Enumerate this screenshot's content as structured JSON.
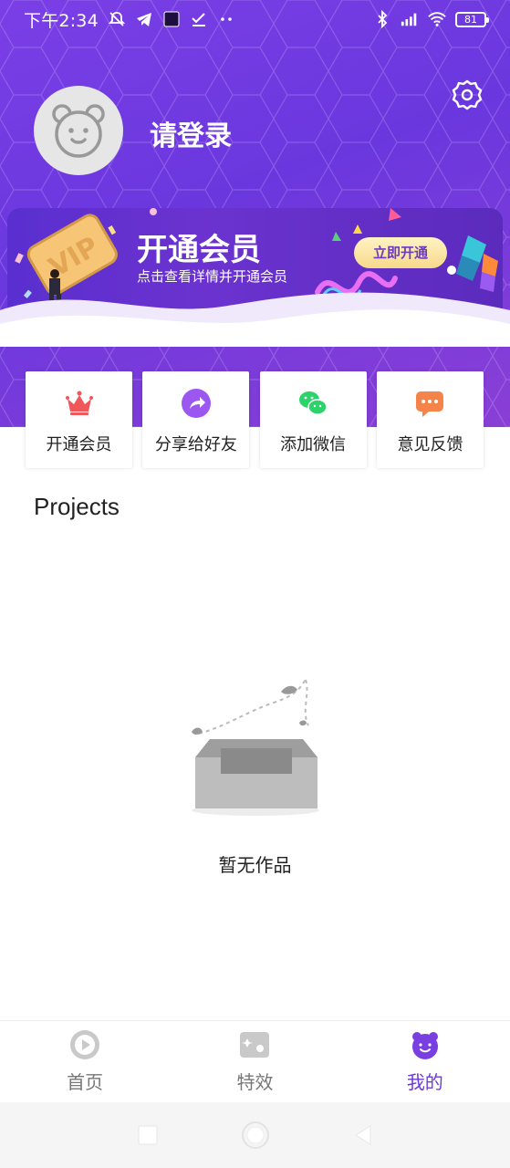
{
  "status_bar": {
    "time": "下午2:34",
    "battery": "81"
  },
  "profile": {
    "login_text": "请登录"
  },
  "vip_banner": {
    "badge_text": "VIP",
    "title": "开通会员",
    "subtitle": "点击查看详情并开通会员",
    "button_label": "立即开通"
  },
  "actions": [
    {
      "label": "开通会员",
      "icon": "crown-icon",
      "color": "#f0575b"
    },
    {
      "label": "分享给好友",
      "icon": "share-icon",
      "color": "#9b57f0"
    },
    {
      "label": "添加微信",
      "icon": "wechat-icon",
      "color": "#2bd36a"
    },
    {
      "label": "意见反馈",
      "icon": "feedback-icon",
      "color": "#f5844a"
    }
  ],
  "projects": {
    "title": "Projects",
    "empty_text": "暂无作品"
  },
  "bottom_nav": [
    {
      "label": "首页",
      "icon": "play-icon",
      "active": false
    },
    {
      "label": "特效",
      "icon": "effects-icon",
      "active": false
    },
    {
      "label": "我的",
      "icon": "mine-icon",
      "active": true
    }
  ],
  "colors": {
    "accent": "#6c3ad6",
    "header_start": "#7b3fe6",
    "header_end": "#8a3fd6"
  }
}
